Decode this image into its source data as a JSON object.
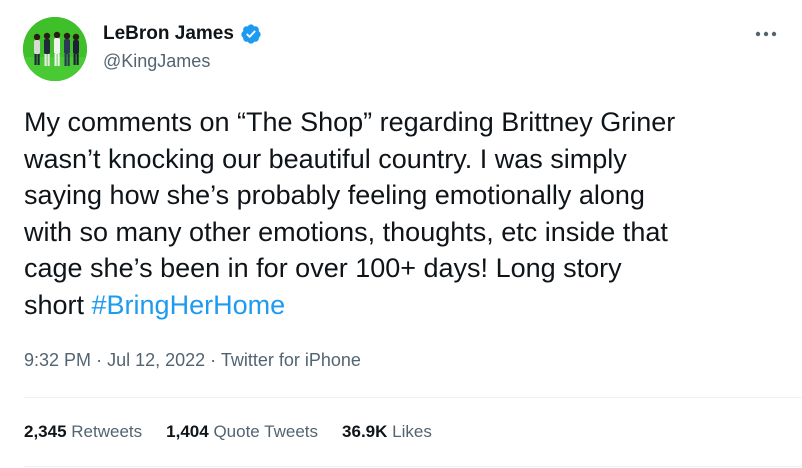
{
  "author": {
    "display_name": "LeBron James",
    "handle": "@KingJames",
    "verified": true
  },
  "tweet": {
    "lines": [
      "My comments on “The Shop” regarding Brittney Griner",
      "wasn’t knocking our beautiful country. I was simply",
      "saying how she’s probably feeling emotionally along",
      "with so many other emotions, thoughts, etc inside that",
      "cage she’s been in for over 100+ days! Long story"
    ],
    "last_line_text": "short ",
    "hashtag": "#BringHerHome"
  },
  "meta": {
    "time": "9:32 PM",
    "separator": "·",
    "date": "Jul 12, 2022",
    "source": "Twitter for iPhone"
  },
  "stats": {
    "retweets_count": "2,345",
    "retweets_label": "Retweets",
    "quotes_count": "1,404",
    "quotes_label": "Quote Tweets",
    "likes_count": "36.9K",
    "likes_label": "Likes"
  },
  "colors": {
    "accent": "#1d9bf0",
    "secondary_text": "#536471",
    "primary_text": "#0f1419",
    "divider": "#eff3f4",
    "avatar_bg": "#3fbf2a"
  },
  "icons": {
    "verified": "verified-badge-icon",
    "more": "more-dots-icon"
  }
}
